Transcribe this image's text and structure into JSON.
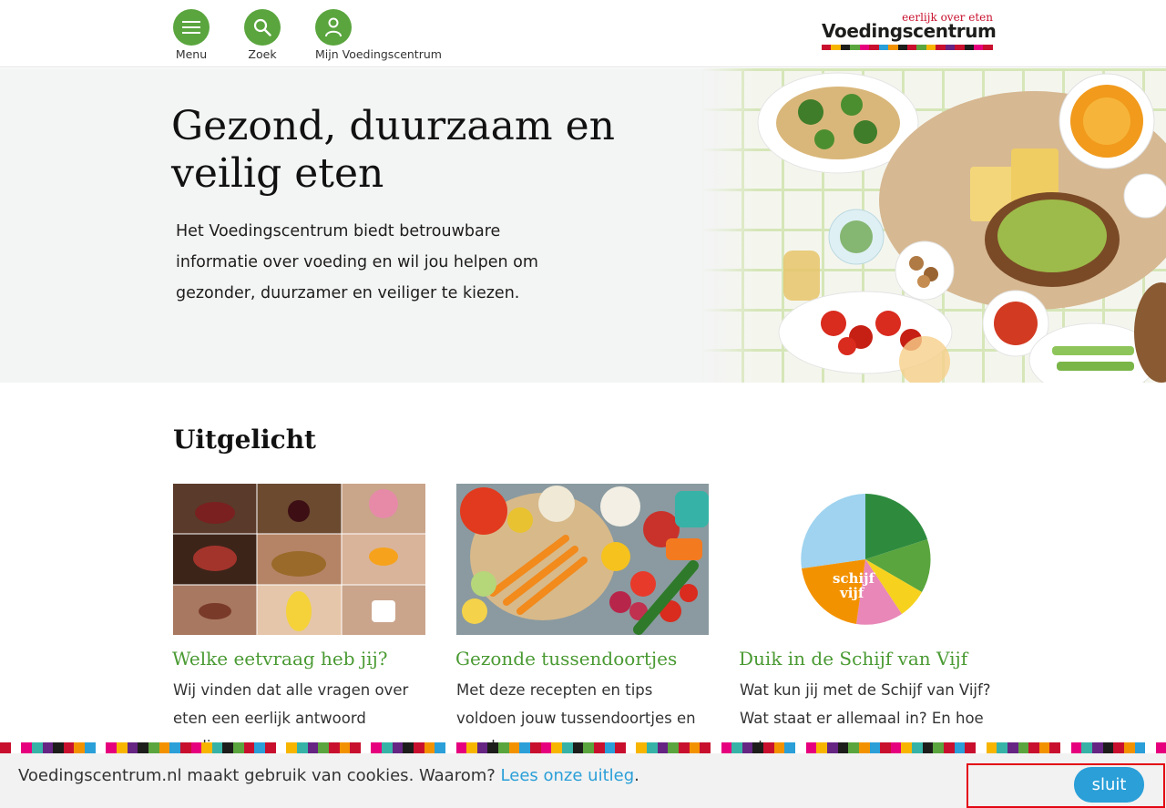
{
  "header": {
    "menu_label": "Menu",
    "search_label": "Zoek",
    "account_label": "Mijn Voedingscentrum",
    "logo_tagline": "eerlijk over eten",
    "logo_name": "Voedingscentrum",
    "accent_color": "#5aa53e"
  },
  "hero": {
    "title": "Gezond, duurzaam en veilig eten",
    "text": "Het Voedingscentrum biedt betrouwbare informatie over voeding en wil jou helpen om gezonder, duurzamer en veiliger te kiezen."
  },
  "featured": {
    "title": "Uitgelicht",
    "cards": [
      {
        "title": "Welke eetvraag heb jij?",
        "text": "Wij vinden dat alle vragen over eten een eerlijk antwoord verdienen."
      },
      {
        "title": "Gezonde tussendoortjes",
        "text": "Met deze recepten en tips voldoen jouw tussendoortjes en snacks aan"
      },
      {
        "title": "Duik in de Schijf van Vijf",
        "text": "Wat kun jij met de Schijf van Vijf? Wat staat er allemaal in? En hoe eet",
        "image_label_top": "schijf",
        "image_label_bottom": "vijf"
      }
    ]
  },
  "cookie": {
    "text": "Voedingscentrum.nl maakt gebruik van cookies. Waarom? ",
    "link": "Lees onze uitleg",
    "after_link": ".",
    "close_label": "sluit"
  }
}
